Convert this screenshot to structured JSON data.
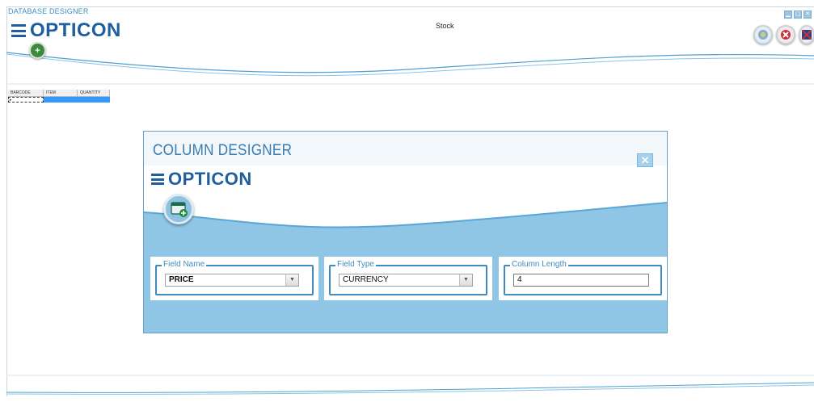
{
  "app": {
    "title": "DATABASE DESIGNER",
    "logo_text": "OPTICON",
    "document_title": "Stock"
  },
  "window_controls": [
    "minimize",
    "maximize",
    "close"
  ],
  "toolbar": {
    "add_icon": "plus-icon",
    "right_buttons": [
      "settings-icon",
      "close-circle-icon",
      "flag-icon"
    ]
  },
  "grid": {
    "columns": [
      "BARCODE",
      "ITEM",
      "QUANTITY"
    ],
    "row_indicator": "▸"
  },
  "dialog": {
    "title": "COLUMN DESIGNER",
    "logo_text": "OPTICON",
    "close_symbol": "✕",
    "fields": {
      "field_name": {
        "label": "Field Name",
        "value": "PRICE"
      },
      "field_type": {
        "label": "Field Type",
        "value": "CURRENCY"
      },
      "column_length": {
        "label": "Column Length",
        "value": "4"
      }
    }
  },
  "colors": {
    "accent": "#3f8bc0",
    "dialog_bg": "#8fc6e6",
    "logo": "#1f5fa0",
    "title_text": "#3a8fc4"
  }
}
